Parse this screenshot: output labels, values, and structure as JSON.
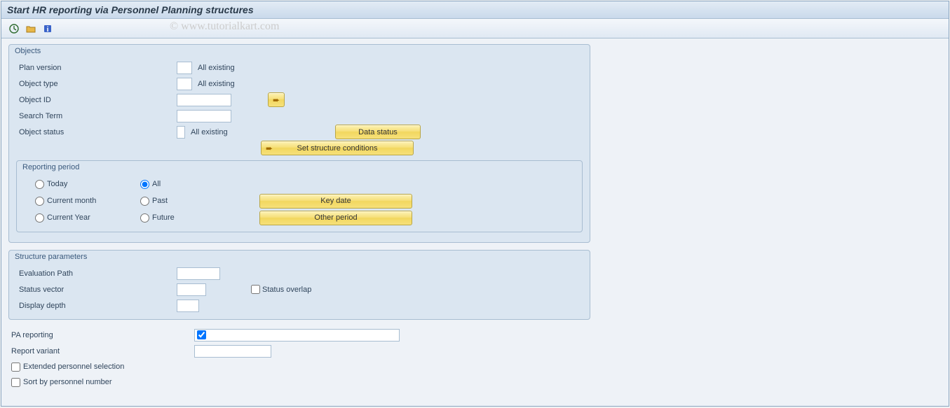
{
  "title": "Start HR reporting via Personnel Planning structures",
  "watermark": "© www.tutorialkart.com",
  "toolbar": {
    "execute": "execute-icon",
    "variant": "get-variant-icon",
    "info": "info-icon"
  },
  "objects": {
    "title": "Objects",
    "plan_version": {
      "label": "Plan version",
      "value": "",
      "status_text": "All existing"
    },
    "object_type": {
      "label": "Object type",
      "value": "",
      "status_text": "All existing"
    },
    "object_id": {
      "label": "Object ID",
      "value": ""
    },
    "search_term": {
      "label": "Search Term",
      "value": ""
    },
    "object_status": {
      "label": "Object status",
      "value": "",
      "status_text": "All existing"
    },
    "buttons": {
      "multiple_selection": "➨",
      "data_status": "Data status",
      "set_structure_conditions": "Set structure conditions"
    }
  },
  "reporting_period": {
    "title": "Reporting period",
    "options": {
      "today": "Today",
      "current_month": "Current month",
      "current_year": "Current Year",
      "all": "All",
      "past": "Past",
      "future": "Future"
    },
    "selected": "all",
    "buttons": {
      "key_date": "Key date",
      "other_period": "Other period"
    }
  },
  "structure_parameters": {
    "title": "Structure parameters",
    "evaluation_path": {
      "label": "Evaluation Path",
      "value": ""
    },
    "status_vector": {
      "label": "Status vector",
      "value": ""
    },
    "status_overlap": {
      "label": "Status overlap",
      "checked": false
    },
    "display_depth": {
      "label": "Display depth",
      "value": ""
    }
  },
  "bottom": {
    "pa_reporting": {
      "label": "PA reporting",
      "checked": true
    },
    "report_variant": {
      "label": "Report variant",
      "value": ""
    },
    "extended_personnel_selection": {
      "label": "Extended personnel selection",
      "checked": false
    },
    "sort_by_personnel_number": {
      "label": "Sort by personnel number",
      "checked": false
    }
  }
}
